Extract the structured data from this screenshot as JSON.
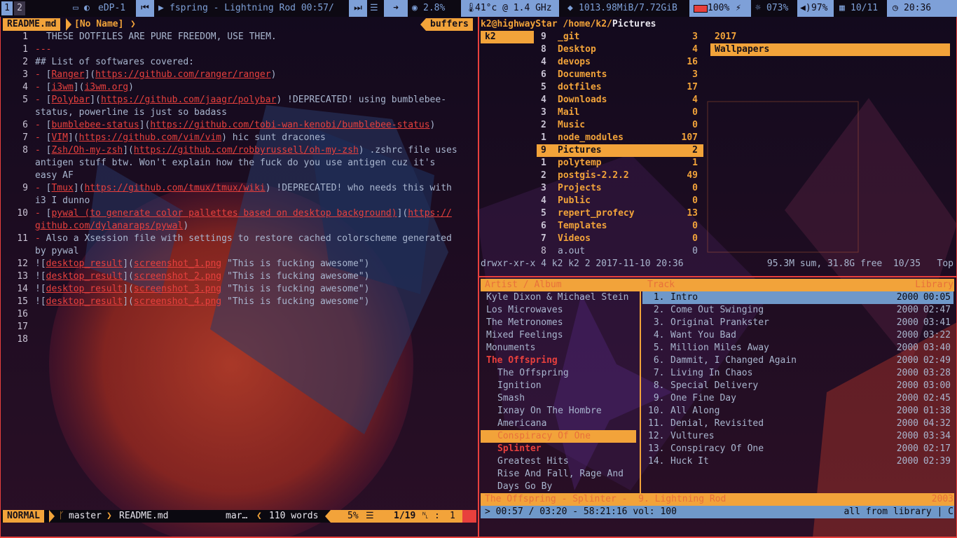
{
  "topbar": {
    "workspaces": [
      "1",
      "2"
    ],
    "display": "eDP-1",
    "now_playing": "fspring - Lightning Rod 00:57/",
    "cpu": "2.8%",
    "temp": "41°c @ 1.4 GHz",
    "mem": "1013.98MiB/7.72GiB",
    "battery": "100%",
    "brightness": "073%",
    "volume": "97%",
    "date": "10/11",
    "time": "20:36"
  },
  "vim": {
    "tab_file": "README.md",
    "tab_noname": "[No Name]",
    "buffers_label": "buffers",
    "lines": [
      {
        "n": "1",
        "text": "THESE DOTFILES ARE PURE FREEDOM, USE THEM."
      },
      {
        "n": "1",
        "text": "---"
      },
      {
        "n": "2",
        "text": "## List of softwares covered:"
      },
      {
        "n": "3",
        "dash": "- ",
        "lt": "Ranger",
        "url": "https://github.com/ranger/ranger",
        "tail": ""
      },
      {
        "n": "4",
        "dash": "- ",
        "lt": "i3wm",
        "url": "i3wm.org",
        "tail": ""
      },
      {
        "n": "5",
        "dash": "- ",
        "lt": "Polybar",
        "url": "https://github.com/jaagr/polybar",
        "tail": " !DEPRECATED! using bumblebee-"
      },
      {
        "n": "",
        "text": "status, powerline is just so badass"
      },
      {
        "n": "6",
        "dash": "- ",
        "lt": "bumblebee-status",
        "url": "https://github.com/tobi-wan-kenobi/bumblebee-status",
        "tail": ""
      },
      {
        "n": "7",
        "dash": "- ",
        "lt": "VIM",
        "url": "https://github.com/vim/vim",
        "tail": " hic sunt dracones"
      },
      {
        "n": "8",
        "dash": "- ",
        "lt": "Zsh/Oh-my-zsh",
        "url": "https://github.com/robbyrussell/oh-my-zsh",
        "tail": " .zshrc file uses"
      },
      {
        "n": "",
        "text": "antigen stuff btw. Won't explain how the fuck do you use antigen cuz it's"
      },
      {
        "n": "",
        "text": "easy AF"
      },
      {
        "n": "9",
        "dash": "- ",
        "lt": "Tmux",
        "url": "https://github.com/tmux/tmux/wiki",
        "tail": " !DEPRECATED! who needs this with"
      },
      {
        "n": "",
        "text": "i3 I dunno"
      },
      {
        "n": "10",
        "dash": "- ",
        "lt": "pywal (to generate color pallettes based on desktop background)",
        "url": "https://",
        "tail": ""
      },
      {
        "n": "",
        "url2": "github.com/dylanaraps/pywal",
        "text": ")"
      },
      {
        "n": "11",
        "dash": "- ",
        "text": "Also a Xsession file with settings to restore cached colorscheme generated"
      },
      {
        "n": "",
        "text": "by pywal"
      },
      {
        "n": "12",
        "img": "desktop_result",
        "file": "screenshot_1.png",
        "title": "\"This is fucking awesome\""
      },
      {
        "n": "13",
        "img": "desktop_result",
        "file": "screenshot_2.png",
        "title": "\"This is fucking awesome\""
      },
      {
        "n": "14",
        "img": "desktop_result",
        "file": "screenshot_3.png",
        "title": "\"This is fucking awesome\""
      },
      {
        "n": "15",
        "img": "desktop_result",
        "file": "screenshot_4.png",
        "title": "\"This is fucking awesome\""
      },
      {
        "n": "16",
        "text": ""
      },
      {
        "n": "17",
        "text": ""
      },
      {
        "n": "18",
        "text": ""
      }
    ],
    "status": {
      "mode": "NORMAL",
      "branch": "master",
      "file": "README.md",
      "ft": "mar…",
      "words": "110 words",
      "percent": "5%",
      "pos": "1/19",
      "col": "1"
    }
  },
  "ranger": {
    "user_host": "k2@highwayStar",
    "path_prefix": "/home/k2/",
    "path_current": "Pictures",
    "parent": [
      {
        "name": "k2",
        "selected": true
      }
    ],
    "entries": [
      {
        "num": "9",
        "name": "_git",
        "count": "3"
      },
      {
        "num": "8",
        "name": "Desktop",
        "count": "4"
      },
      {
        "num": "4",
        "name": "devops",
        "count": "16"
      },
      {
        "num": "6",
        "name": "Documents",
        "count": "3"
      },
      {
        "num": "5",
        "name": "dotfiles",
        "count": "17"
      },
      {
        "num": "4",
        "name": "Downloads",
        "count": "4"
      },
      {
        "num": "3",
        "name": "Mail",
        "count": "0"
      },
      {
        "num": "2",
        "name": "Music",
        "count": "0"
      },
      {
        "num": "1",
        "name": "node_modules",
        "count": "107"
      },
      {
        "num": "9",
        "name": "Pictures",
        "count": "2",
        "selected": true
      },
      {
        "num": "1",
        "name": "polytemp",
        "count": "1"
      },
      {
        "num": "2",
        "name": "postgis-2.2.2",
        "count": "49"
      },
      {
        "num": "3",
        "name": "Projects",
        "count": "0"
      },
      {
        "num": "4",
        "name": "Public",
        "count": "0"
      },
      {
        "num": "5",
        "name": "repert_profecy",
        "count": "13"
      },
      {
        "num": "6",
        "name": "Templates",
        "count": "0"
      },
      {
        "num": "7",
        "name": "Videos",
        "count": "0"
      },
      {
        "num": "8",
        "name": "a.out",
        "count": "0",
        "file": true
      }
    ],
    "preview": [
      {
        "name": "2017"
      },
      {
        "name": "Wallpapers",
        "selected": true
      }
    ],
    "status_left": "drwxr-xr-x 4 k2 k2 2 2017-11-10 20:36",
    "status_right": "95.3M sum, 31.8G free  10/35   Top"
  },
  "cmus": {
    "header_left": "Artist / Album",
    "header_track": "Track",
    "header_library": "Library",
    "artists": [
      {
        "name": "Kyle Dixon & Michael Stein"
      },
      {
        "name": "Los Microwaves"
      },
      {
        "name": "The Metronomes"
      },
      {
        "name": "Mixed Feelings"
      },
      {
        "name": "Monuments"
      },
      {
        "name": "The Offspring",
        "playing": true
      },
      {
        "name": "The Offspring",
        "album": true
      },
      {
        "name": "Ignition",
        "album": true
      },
      {
        "name": "Smash",
        "album": true
      },
      {
        "name": "Ixnay On The Hombre",
        "album": true
      },
      {
        "name": "Americana",
        "album": true
      },
      {
        "name": "Conspiracy Of One",
        "album": true,
        "selected": true
      },
      {
        "name": "Splinter",
        "album": true,
        "playing": true
      },
      {
        "name": "Greatest Hits",
        "album": true
      },
      {
        "name": "Rise And Fall, Rage And",
        "album": true
      },
      {
        "name": "Days Go By",
        "album": true
      }
    ],
    "tracks": [
      {
        "n": " 1.",
        "title": "Intro",
        "year": "2000",
        "dur": "00:05",
        "selected": true
      },
      {
        "n": " 2.",
        "title": "Come Out Swinging",
        "year": "2000",
        "dur": "02:47"
      },
      {
        "n": " 3.",
        "title": "Original Prankster",
        "year": "2000",
        "dur": "03:41"
      },
      {
        "n": " 4.",
        "title": "Want You Bad",
        "year": "2000",
        "dur": "03:22"
      },
      {
        "n": " 5.",
        "title": "Million Miles Away",
        "year": "2000",
        "dur": "03:40"
      },
      {
        "n": " 6.",
        "title": "Dammit, I Changed Again",
        "year": "2000",
        "dur": "02:49"
      },
      {
        "n": " 7.",
        "title": "Living In Chaos",
        "year": "2000",
        "dur": "03:28"
      },
      {
        "n": " 8.",
        "title": "Special Delivery",
        "year": "2000",
        "dur": "03:00"
      },
      {
        "n": " 9.",
        "title": "One Fine Day",
        "year": "2000",
        "dur": "02:45"
      },
      {
        "n": "10.",
        "title": "All Along",
        "year": "2000",
        "dur": "01:38"
      },
      {
        "n": "11.",
        "title": "Denial, Revisited",
        "year": "2000",
        "dur": "04:32"
      },
      {
        "n": "12.",
        "title": "Vultures",
        "year": "2000",
        "dur": "03:34"
      },
      {
        "n": "13.",
        "title": "Conspiracy Of One",
        "year": "2000",
        "dur": "02:17"
      },
      {
        "n": "14.",
        "title": "Huck It",
        "year": "2000",
        "dur": "02:39"
      }
    ],
    "now_playing": "The Offspring - Splinter -  9. Lightning Rod",
    "now_playing_year": "2003",
    "progress": "> 00:57 / 03:20 - 58:21:16 vol: 100",
    "progress_right": "all from library | C"
  },
  "colors": {
    "accent": "#f2a33a",
    "red": "#e8403d",
    "text": "#a9b6cf",
    "selection_blue": "#6f98c9"
  }
}
